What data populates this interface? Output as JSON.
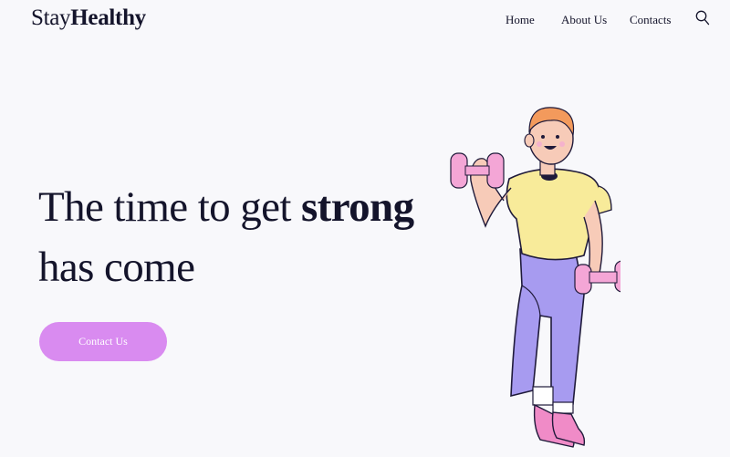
{
  "brand": {
    "prefix": "Stay",
    "bold": "Healthy"
  },
  "nav": {
    "items": [
      "Home",
      "About Us",
      "Contacts"
    ],
    "search_icon": "search-icon"
  },
  "hero": {
    "line1_prefix": "The time to get ",
    "line1_bold": "strong",
    "line2": "has come",
    "cta_label": "Contact Us"
  },
  "colors": {
    "background": "#f8f8fb",
    "text": "#14142b",
    "button": "#d98bf0",
    "dumbbell": "#f4a6d6",
    "shirt": "#f8eb9a",
    "pants": "#a79bf0",
    "hair": "#f39a5c",
    "skin": "#f7cbb8"
  },
  "illustration": {
    "name": "man-lifting-dumbbells-illustration"
  }
}
